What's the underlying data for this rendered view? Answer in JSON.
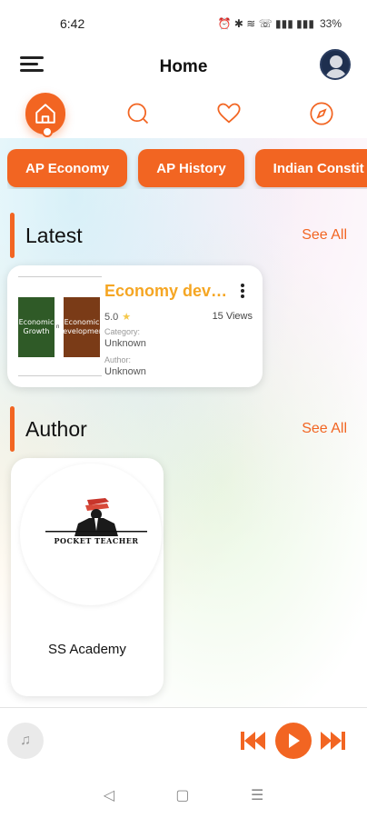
{
  "status_bar": {
    "time": "6:42",
    "icons_text": "⏰ ✱ ≋ ☏ ▮▮▮ ▮▮▮",
    "battery": "33%"
  },
  "header": {
    "title": "Home"
  },
  "nav_tabs": [
    {
      "icon": "home-icon",
      "active": true
    },
    {
      "icon": "search-icon",
      "active": false
    },
    {
      "icon": "heart-icon",
      "active": false
    },
    {
      "icon": "compass-icon",
      "active": false
    }
  ],
  "categories": [
    "AP Economy",
    "AP History",
    "Indian Constit"
  ],
  "latest": {
    "title": "Latest",
    "see_all": "See All",
    "book": {
      "title": "Economy deve...",
      "cover_left": "Economic Growth",
      "cover_mid": "n",
      "cover_right": "Economic Development",
      "rating": "5.0",
      "views": "15 Views",
      "category_label": "Category:",
      "category_value": "Unknown",
      "author_label": "Author:",
      "author_value": "Unknown"
    }
  },
  "author": {
    "title": "Author",
    "see_all": "See All",
    "card": {
      "logo_text": "POCKET TEACHER",
      "name": "SS Academy"
    }
  },
  "player": {
    "icons": [
      "music-icon",
      "previous-icon",
      "play-icon",
      "next-icon"
    ]
  },
  "colors": {
    "accent": "#f26522",
    "book_title": "#f5a623"
  }
}
